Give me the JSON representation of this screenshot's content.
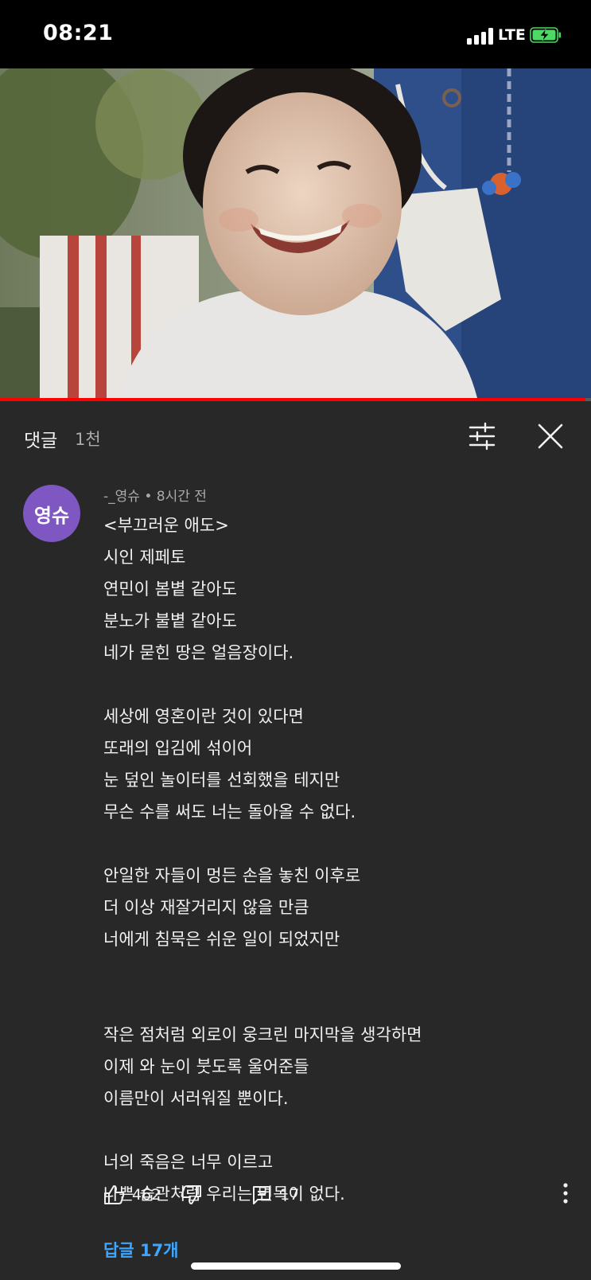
{
  "status": {
    "time": "08:21",
    "network": "LTE"
  },
  "video": {
    "progress_fraction": 0.99
  },
  "header": {
    "title": "댓글",
    "count": "1천"
  },
  "comment": {
    "avatar_text": "영슈",
    "author": "-_영슈",
    "separator": "•",
    "time": "8시간 전",
    "lines": [
      "<부끄러운 애도>",
      "시인 제페토",
      "연민이 봄볕 같아도",
      "분노가 불볕 같아도",
      "네가 묻힌 땅은 얼음장이다.",
      "",
      "세상에 영혼이란 것이 있다면",
      "또래의 입김에 섞이어",
      "눈 덮인 놀이터를 선회했을 테지만",
      "무슨 수를 써도 너는 돌아올 수 없다.",
      "",
      "안일한 자들이 멍든 손을 놓친 이후로",
      "더 이상 재잘거리지 않을 만큼",
      "너에게 침묵은 쉬운 일이 되었지만",
      "",
      "",
      "작은 점처럼 외로이 웅크린 마지막을 생각하면",
      "이제 와 눈이 붓도록 울어준들",
      "이름만이 서러워질 뿐이다.",
      "",
      "너의 죽음은 너무 이르고",
      "나쁜 습관처럼 우리는 면목이 없다."
    ],
    "likes": "462",
    "reply_count": "17",
    "replies_link": "답글 17개"
  },
  "icons": {
    "filter": "sliders-icon",
    "close": "close-icon",
    "like": "thumbs-up-icon",
    "dislike": "thumbs-down-icon",
    "reply": "comment-icon",
    "more": "more-vertical-icon"
  },
  "colors": {
    "accent_link": "#3ea6ff",
    "progress": "#ff0000",
    "avatar": "#7e57c2"
  }
}
